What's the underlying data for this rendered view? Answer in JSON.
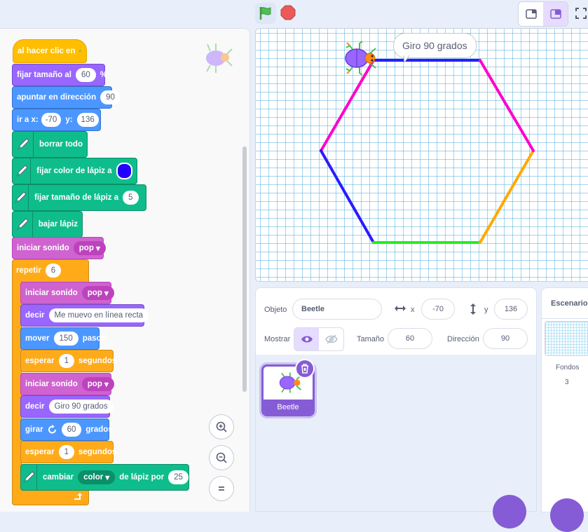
{
  "colors": {
    "accent": "#855cd6",
    "events": "#ffbf00",
    "motion": "#4c97ff",
    "looks": "#9966ff",
    "sound": "#cf63cf",
    "control": "#ffab19",
    "pen": "#0fbd8c",
    "pen_color_swatch": "#2200ff",
    "stage_grid": "#4aa8d8"
  },
  "toolbar": {
    "green_flag_icon": "green-flag-icon",
    "stop_icon": "stop-icon",
    "layout_small_icon": "small-stage-icon",
    "layout_normal_icon": "normal-stage-icon",
    "fullscreen_icon": "fullscreen-icon"
  },
  "script": {
    "b1": "al hacer clic en",
    "b2": {
      "label": "fijar tamaño al",
      "value": "60",
      "suffix": "%"
    },
    "b3": {
      "label": "apuntar en dirección",
      "value": "90"
    },
    "b4": {
      "label": "ir a x:",
      "x": "-70",
      "ylabel": "y:",
      "y": "136"
    },
    "b5": "borrar todo",
    "b6": "fijar color de lápiz a",
    "b7": {
      "label": "fijar tamaño de lápiz a",
      "value": "5"
    },
    "b8": "bajar lápiz",
    "b9": {
      "label": "iniciar sonido",
      "value": "pop"
    },
    "b10": {
      "label": "repetir",
      "value": "6"
    },
    "b11": {
      "label": "iniciar sonido",
      "value": "pop"
    },
    "b12": {
      "label": "decir",
      "value": "Me muevo en línea recta"
    },
    "b13": {
      "label": "mover",
      "value": "150",
      "suffix": "pasos"
    },
    "b14": {
      "label": "esperar",
      "value": "1",
      "suffix": "segundos"
    },
    "b15": {
      "label": "iniciar sonido",
      "value": "pop"
    },
    "b16": {
      "label": "decir",
      "value": "Giro 90 grados"
    },
    "b17": {
      "label": "girar",
      "value": "60",
      "suffix": "grados"
    },
    "b18": {
      "label": "esperar",
      "value": "1",
      "suffix": "segundos"
    },
    "b19": {
      "label": "cambiar",
      "dd": "color",
      "mid": "de lápiz por",
      "value": "25"
    }
  },
  "stage": {
    "speech": "Giro 90 grados",
    "hexagon_edges": [
      {
        "color": "#2a1bff"
      },
      {
        "color": "#ff00cc"
      },
      {
        "color": "#2a1bff"
      },
      {
        "color": "#22ee22"
      },
      {
        "color": "#ffaa00"
      },
      {
        "color": "#ff00cc"
      }
    ]
  },
  "sprite_info": {
    "sprite_label": "Objeto",
    "sprite_name": "Beetle",
    "x_label": "x",
    "x": "-70",
    "y_label": "y",
    "y": "136",
    "show_label": "Mostrar",
    "size_label": "Tamaño",
    "size": "60",
    "direction_label": "Dirección",
    "direction": "90"
  },
  "sprites": [
    {
      "name": "Beetle"
    }
  ],
  "stage_pane": {
    "title": "Escenario",
    "backdrops_label": "Fondos",
    "backdrops_count": "3"
  }
}
